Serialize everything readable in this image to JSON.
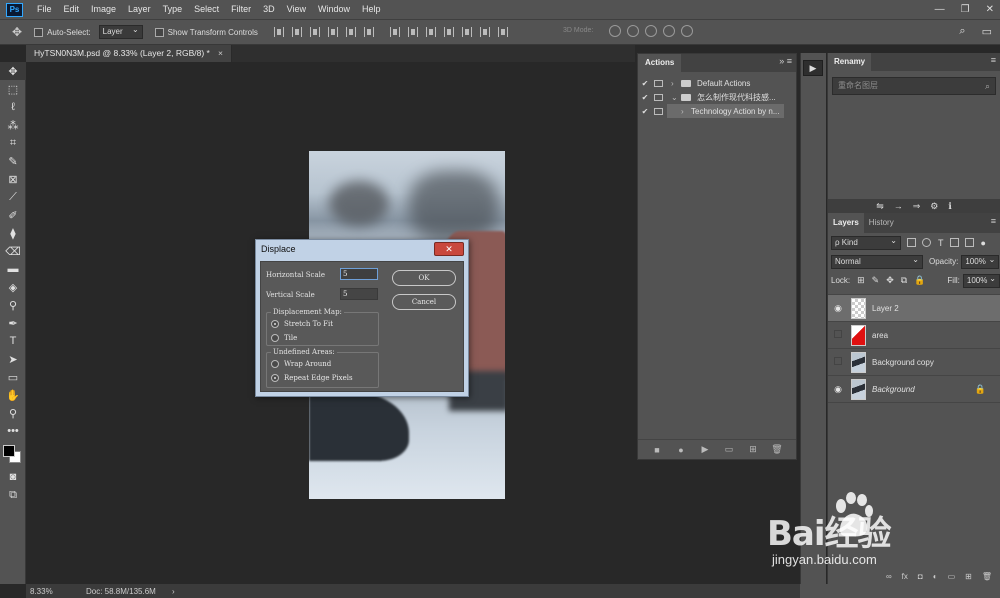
{
  "menubar": {
    "logo": "Ps",
    "items": [
      "File",
      "Edit",
      "Image",
      "Layer",
      "Type",
      "Select",
      "Filter",
      "3D",
      "View",
      "Window",
      "Help"
    ],
    "minimize": "—",
    "maximize": "❐",
    "close": "✕"
  },
  "options": {
    "auto_select_label": "Auto-Select:",
    "auto_select_value": "Layer",
    "transform_label": "Show Transform Controls",
    "mode3d_label": "3D Mode:"
  },
  "document": {
    "tab_title": "HyTSN0N3M.psd @ 8.33% (Layer 2, RGB/8) *",
    "tab_close": "×"
  },
  "actions_panel": {
    "tab": "Actions",
    "collapse": "»",
    "menu": "≡",
    "rows": [
      {
        "check": "✔",
        "arrow": "›",
        "label": "Default Actions",
        "selected": false
      },
      {
        "check": "✔",
        "arrow": "⌄",
        "label": "怎么制作现代科技感...",
        "selected": false
      },
      {
        "check": "✔",
        "arrow": "›",
        "label": "Technology Action by n...",
        "selected": true
      }
    ],
    "footer_buttons": [
      "■",
      "●",
      "▶",
      "▭",
      "⊞",
      "🗑"
    ]
  },
  "renamy_panel": {
    "tab": "Renamy",
    "search_placeholder": "重命名图层",
    "icons": [
      "⇋",
      "→",
      "⇒",
      "⚙",
      "ℹ"
    ]
  },
  "layers_panel": {
    "tabs": [
      "Layers",
      "History"
    ],
    "kind_label": "ρ Kind",
    "blend_mode": "Normal",
    "opacity_label": "Opacity:",
    "opacity_value": "100%",
    "lock_label": "Lock:",
    "fill_label": "Fill:",
    "fill_value": "100%",
    "layers": [
      {
        "name": "Layer 2",
        "visible": true,
        "selected": true,
        "thumb": "checker",
        "italic": false,
        "locked": false
      },
      {
        "name": "area",
        "visible": false,
        "selected": false,
        "thumb": "red",
        "italic": false,
        "locked": false
      },
      {
        "name": "Background copy",
        "visible": false,
        "selected": false,
        "thumb": "photo",
        "italic": false,
        "locked": false
      },
      {
        "name": "Background",
        "visible": true,
        "selected": false,
        "thumb": "photo",
        "italic": true,
        "locked": true
      }
    ],
    "footer_icons": [
      "∞",
      "fx",
      "◘",
      "◐",
      "▭",
      "⊞",
      "🗑"
    ]
  },
  "status": {
    "zoom": "8.33%",
    "doc_info": "Doc: 58.8M/135.6M",
    "arrow": "›"
  },
  "displace_dialog": {
    "title": "Displace",
    "close_glyph": "✕",
    "horizontal_scale_label": "Horizontal Scale",
    "horizontal_scale_value": "5",
    "vertical_scale_label": "Vertical Scale",
    "vertical_scale_value": "5",
    "ok_label": "OK",
    "cancel_label": "Cancel",
    "displacement_map_title": "Displacement Map:",
    "stretch_label": "Stretch To Fit",
    "tile_label": "Tile",
    "undefined_areas_title": "Undefined Areas:",
    "wrap_label": "Wrap Around",
    "repeat_label": "Repeat Edge Pixels"
  },
  "watermark": {
    "brand": "Bai经验",
    "url": "jingyan.baidu.com"
  },
  "tools": [
    "✥",
    "⬚",
    "ℓ",
    "⁂",
    "⌗",
    "✎",
    "⊠",
    "⟋",
    "✐",
    "⧫",
    "⌫",
    "▬",
    "◈",
    "⚲",
    "✒",
    "T",
    "➤",
    "▭",
    "✋",
    "⚲",
    "•••"
  ]
}
